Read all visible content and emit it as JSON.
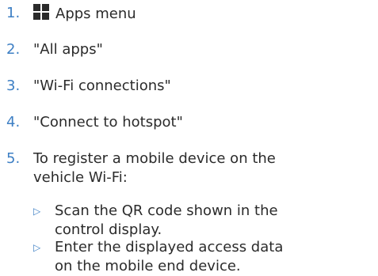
{
  "steps": [
    {
      "number": "1.",
      "text": "Apps menu",
      "icon": "apps-grid-icon"
    },
    {
      "number": "2.",
      "text": "\"All apps\""
    },
    {
      "number": "3.",
      "text": "\"Wi-Fi connections\""
    },
    {
      "number": "4.",
      "text": "\"Connect to hotspot\""
    },
    {
      "number": "5.",
      "text": "To register a mobile device on the vehicle Wi-Fi:"
    }
  ],
  "bullets": [
    {
      "marker": "▷",
      "text": "Scan the QR code shown in the control display."
    },
    {
      "marker": "▷",
      "text": "Enter the displayed access data on the mobile end device."
    }
  ],
  "colors": {
    "number_accent": "#3d7fc4",
    "text": "#2b2b2b"
  }
}
